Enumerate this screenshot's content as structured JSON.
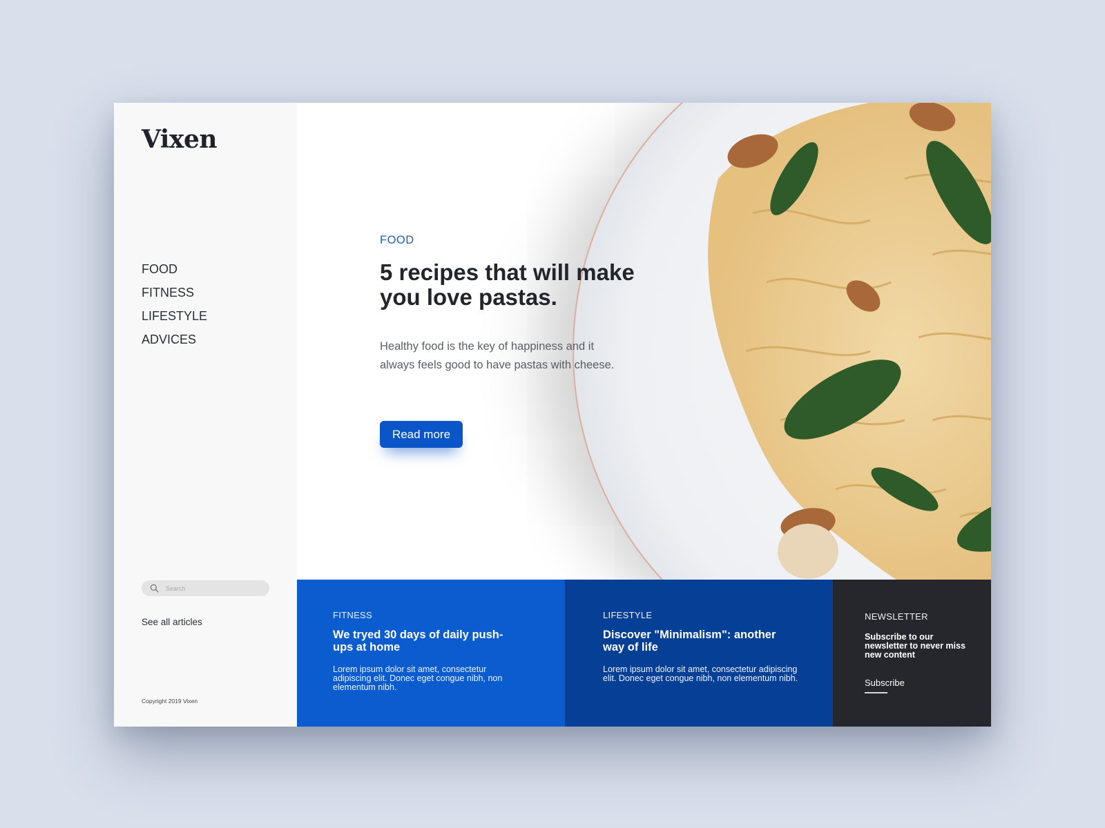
{
  "brand": {
    "logo": "Vixen"
  },
  "sidebar": {
    "nav": [
      {
        "label": "FOOD"
      },
      {
        "label": "FITNESS"
      },
      {
        "label": "LIFESTYLE"
      },
      {
        "label": "ADVICES"
      }
    ],
    "search": {
      "placeholder": "Search"
    },
    "see_all": "See all articles",
    "copyright": "Copyright 2019 Vixen"
  },
  "hero": {
    "category": "FOOD",
    "title": "5 recipes that will make you love pastas.",
    "description": "Healthy food is the key of happiness and it always feels good to have pastas with cheese.",
    "cta": "Read more",
    "image_icon": "pasta-plate-image"
  },
  "cards": [
    {
      "category": "FITNESS",
      "title": "We tryed 30 days of daily push-ups at home",
      "body": "Lorem ipsum dolor sit amet, consectetur adipiscing elit. Donec eget congue nibh, non elementum nibh."
    },
    {
      "category": "LIFESTYLE",
      "title": "Discover \"Minimalism\": another way of life",
      "body": "Lorem ipsum dolor sit amet, consectetur adipiscing elit. Donec eget congue nibh, non elementum nibh."
    }
  ],
  "newsletter": {
    "category": "NEWSLETTER",
    "text": "Subscribe to our newsletter to never miss new content",
    "action": "Subscribe"
  },
  "colors": {
    "accent": "#0a56c9",
    "fitness_bg": "#0a5ccf",
    "lifestyle_bg": "#063f96",
    "newsletter_bg": "#25272c",
    "category_text": "#1b5fb8"
  }
}
